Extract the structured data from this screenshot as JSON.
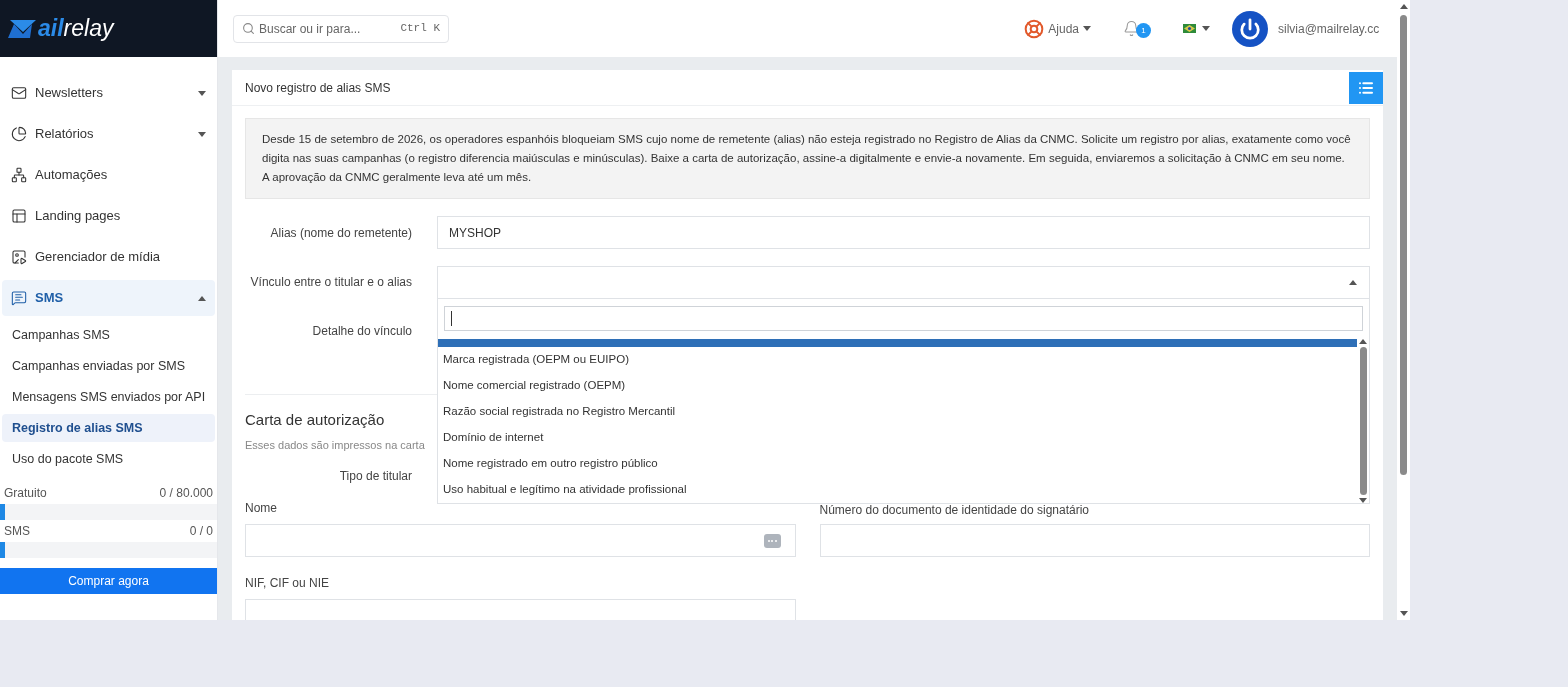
{
  "logo": {
    "text": "ailrelay"
  },
  "search": {
    "placeholder": "Buscar ou ir para...",
    "shortcut": "Ctrl K"
  },
  "topbar": {
    "help": "Ajuda",
    "notifications": "1",
    "user": "silvia@mailrelay.cc"
  },
  "sidebar": {
    "items": [
      {
        "label": "Newsletters",
        "expanded": false,
        "selected": false
      },
      {
        "label": "Relatórios",
        "expanded": false,
        "selected": false
      },
      {
        "label": "Automações",
        "selected": false
      },
      {
        "label": "Landing pages",
        "selected": false
      },
      {
        "label": "Gerenciador de mídia",
        "selected": false
      },
      {
        "label": "SMS",
        "expanded": true,
        "selected": true,
        "children": [
          {
            "label": "Campanhas SMS",
            "selected": false
          },
          {
            "label": "Campanhas enviadas por SMS",
            "selected": false
          },
          {
            "label": "Mensagens SMS enviados por API",
            "selected": false
          },
          {
            "label": "Registro de alias SMS",
            "selected": true
          },
          {
            "label": "Uso do pacote SMS",
            "selected": false
          }
        ]
      }
    ],
    "usage": [
      {
        "label": "Gratuito",
        "reading": "0 / 80.000",
        "level": 0.02
      },
      {
        "label": "SMS",
        "reading": "0 / 0",
        "level": 0.02
      }
    ],
    "buy_button": "Comprar agora"
  },
  "card": {
    "title": "Novo registro de alias SMS",
    "info": "Desde 15 de setembro de 2026, os operadores espanhóis bloqueiam SMS cujo nome de remetente (alias) não esteja registrado no Registro de Alias da CNMC. Solicite um registro por alias, exatamente como você digita nas suas campanhas (o registro diferencia maiúsculas e minúsculas). Baixe a carta de autorização, assine-a digitalmente e envie-a novamente. Em seguida, enviaremos a solicitação à CNMC em seu nome. A aprovação da CNMC geralmente leva até um mês.",
    "alias": {
      "label": "Alias (nome do remetente)",
      "value": "MYSHOP"
    },
    "link": {
      "label": "Vínculo entre o titular e o alias",
      "expanded": true,
      "options": [
        {
          "label": "Marca registrada (OEPM ou EUIPO)",
          "selected": false
        },
        {
          "label": "Nome comercial registrado (OEPM)",
          "selected": false
        },
        {
          "label": "Razão social registrada no Registro Mercantil",
          "selected": false
        },
        {
          "label": "Domínio de internet",
          "selected": false
        },
        {
          "label": "Nome registrado em outro registro público",
          "selected": false
        },
        {
          "label": "Uso habitual e legítimo na atividade profissional",
          "selected": false
        }
      ]
    },
    "detail": {
      "label": "Detalhe do vínculo"
    },
    "letter": {
      "title": "Carta de autorização",
      "subtitle": "Esses dados são impressos na carta",
      "holder_type": "Tipo de titular",
      "name": "Nome",
      "document": "Número do documento de identidade do signatário",
      "nif": "NIF, CIF ou NIE"
    }
  }
}
